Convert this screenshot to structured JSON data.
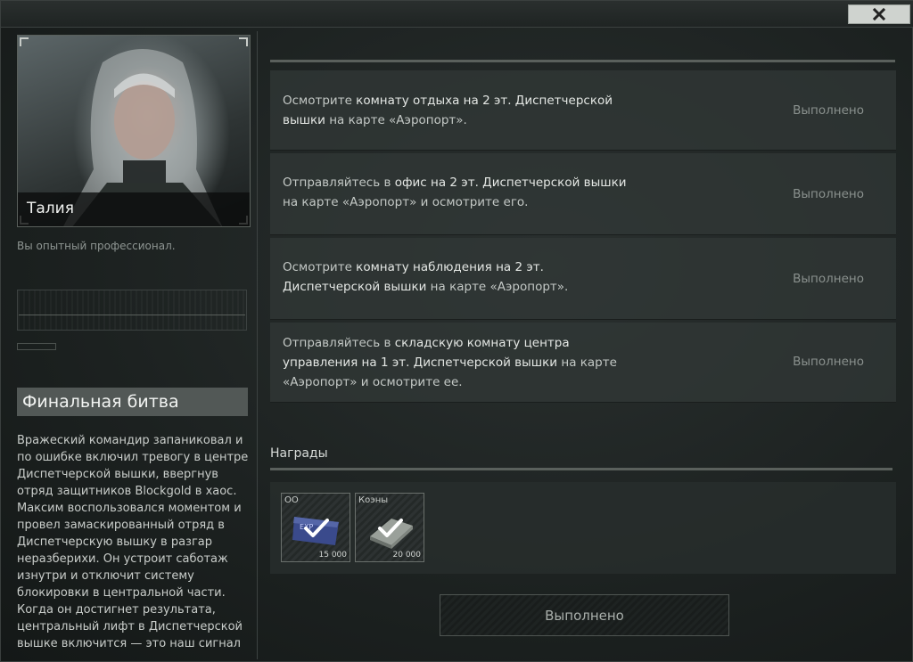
{
  "window": {
    "close_label": "✕"
  },
  "trader": {
    "name": "Талия",
    "subtitle": "Вы опытный профессионал."
  },
  "quest": {
    "title": "Финальная битва",
    "description": "Вражеский командир запаниковал и по ошибке включил тревогу в центре Диспетчерской вышки, ввергнув отряд защитников Blockgold в хаос. Максим воспользовался моментом и провел замаскированный отряд в Диспетчерскую вышку в разгар неразберихи. Он устроит саботаж изнутри и отключит систему блокировки в центральной части. Когда он достигнет результата, центральный лифт в Диспетчерской вышке включится — это наш сигнал к"
  },
  "tasks": [
    {
      "parts": [
        {
          "text": "Осмотрите ",
          "dim": true
        },
        {
          "text": "комнату отдыха на 2 эт. Диспетчерской вышки",
          "dim": false
        },
        {
          "text": " на карте «Аэропорт».",
          "dim": true
        }
      ],
      "status": "Выполнено"
    },
    {
      "parts": [
        {
          "text": "Отправляйтесь в ",
          "dim": true
        },
        {
          "text": "офис на 2 эт. Диспетчерской вышки",
          "dim": false
        },
        {
          "text": " на карте «Аэропорт» и осмотрите его.",
          "dim": true
        }
      ],
      "status": "Выполнено"
    },
    {
      "parts": [
        {
          "text": "Осмотрите ",
          "dim": true
        },
        {
          "text": "комнату наблюдения на 2 эт. Диспетчерской вышки",
          "dim": false
        },
        {
          "text": " на карте «Аэропорт».",
          "dim": true
        }
      ],
      "status": "Выполнено"
    },
    {
      "parts": [
        {
          "text": "Отправляйтесь в ",
          "dim": true
        },
        {
          "text": "складскую комнату центра управления на 1 эт. Диспетчерской вышки",
          "dim": false
        },
        {
          "text": " на карте «Аэропорт» и осмотрите ее.",
          "dim": true
        }
      ],
      "status": "Выполнено"
    }
  ],
  "rewards": {
    "title": "Награды",
    "items": [
      {
        "name": "ОО",
        "count": "15 000",
        "icon": "exp-icon"
      },
      {
        "name": "Коэны",
        "count": "20 000",
        "icon": "money-icon"
      }
    ]
  },
  "footer": {
    "button_label": "Выполнено"
  },
  "colors": {
    "accent": "#525856",
    "text_primary": "#e4e7e4",
    "text_status": "#8a918e",
    "close_button_bg": "#cfd3cf"
  }
}
